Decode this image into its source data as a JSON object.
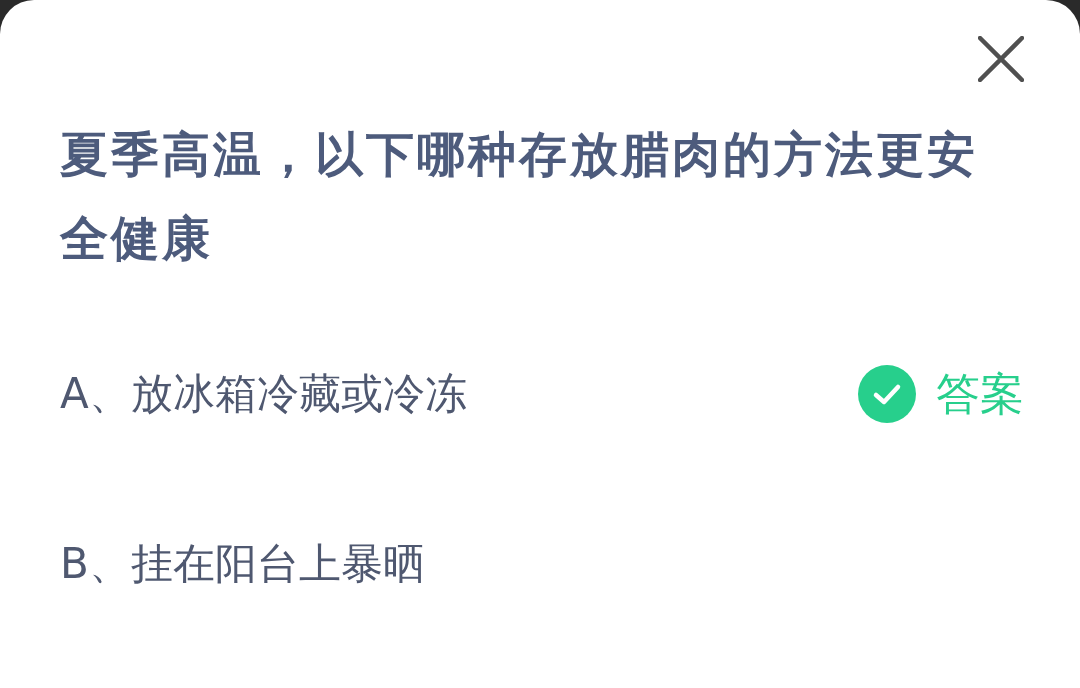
{
  "question": "夏季高温，以下哪种存放腊肉的方法更安全健康",
  "options": [
    {
      "text": "A、放冰箱冷藏或冷冻",
      "correct": true,
      "badge": "答案"
    },
    {
      "text": "B、挂在阳台上暴晒",
      "correct": false
    }
  ]
}
